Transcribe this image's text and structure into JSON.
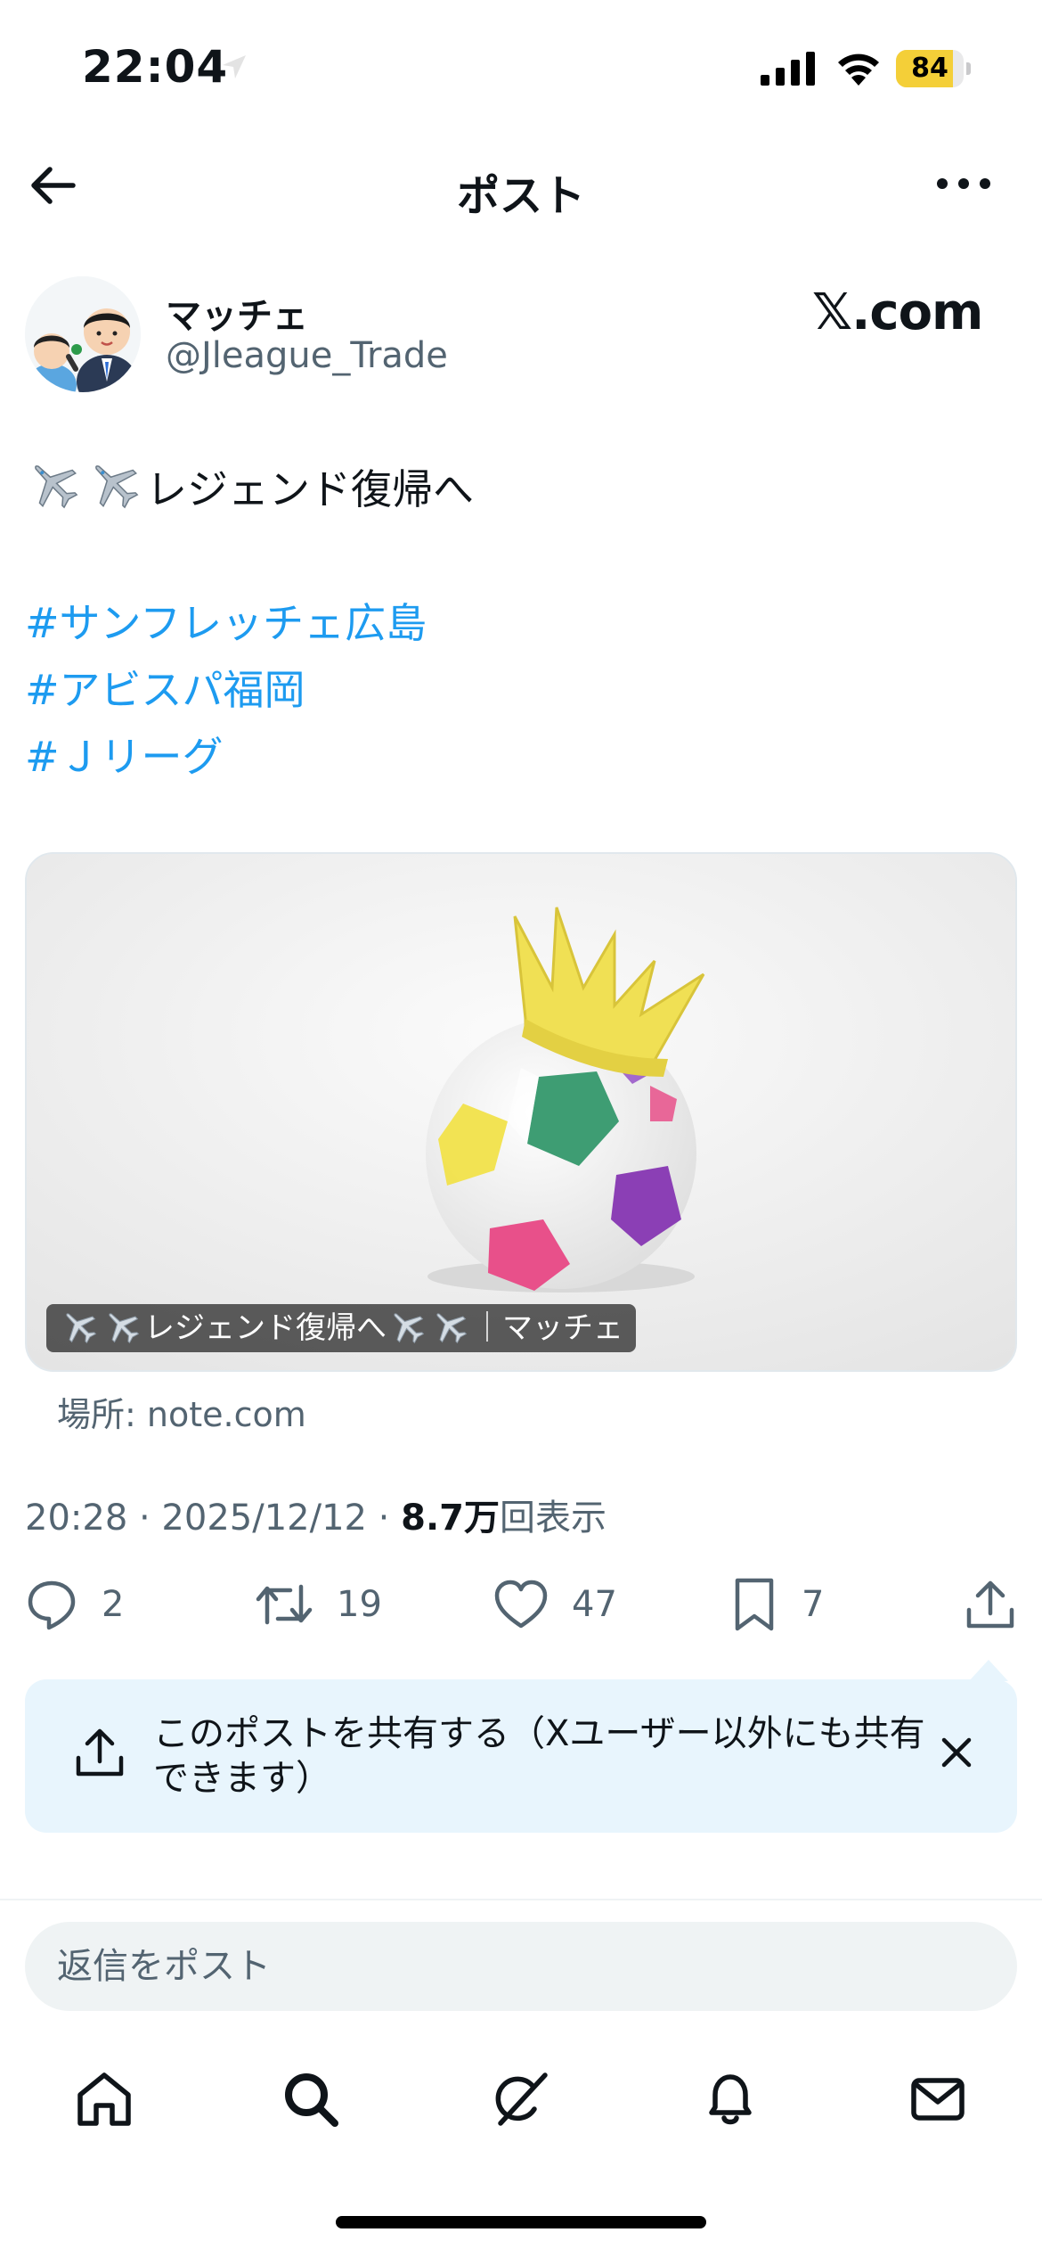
{
  "status_bar": {
    "time": "22:04",
    "battery": "84",
    "battery_level": 0.84
  },
  "header": {
    "title": "ポスト"
  },
  "post": {
    "author": {
      "name": "マッチェ",
      "handle": "@Jleague_Trade"
    },
    "source_logo": "𝕏.com",
    "text_line1": "レジェンド復帰へ",
    "hashtags": [
      "#サンフレッチェ広島",
      "#アビスパ福岡",
      "#Ｊリーグ"
    ],
    "link_card": {
      "caption_part1": "レジェンド復帰へ",
      "caption_part2": "｜マッチェ",
      "source": "場所: note.com"
    },
    "meta": {
      "time_date": "20:28 · 2025/12/12 · ",
      "views_number": "8.7万",
      "views_suffix": "回表示"
    },
    "actions": {
      "replies": "2",
      "reposts": "19",
      "likes": "47",
      "bookmarks": "7"
    }
  },
  "share_banner": {
    "text": "このポストを共有する（Xユーザー以外にも共有できます）"
  },
  "reply": {
    "placeholder": "返信をポスト"
  },
  "icons": [
    "location-arrow-icon",
    "signal-icon",
    "wifi-icon",
    "battery-icon",
    "back-arrow-icon",
    "more-icon",
    "airplane-icon",
    "reply-icon",
    "repost-icon",
    "like-icon",
    "bookmark-icon",
    "share-icon",
    "close-icon",
    "home-icon",
    "search-icon",
    "grok-icon",
    "notifications-icon",
    "messages-icon"
  ],
  "colors": {
    "link": "#1d9bf0",
    "secondary_text": "#536471",
    "share_banner_bg": "#e8f5fd",
    "battery": "#f4cf38"
  }
}
